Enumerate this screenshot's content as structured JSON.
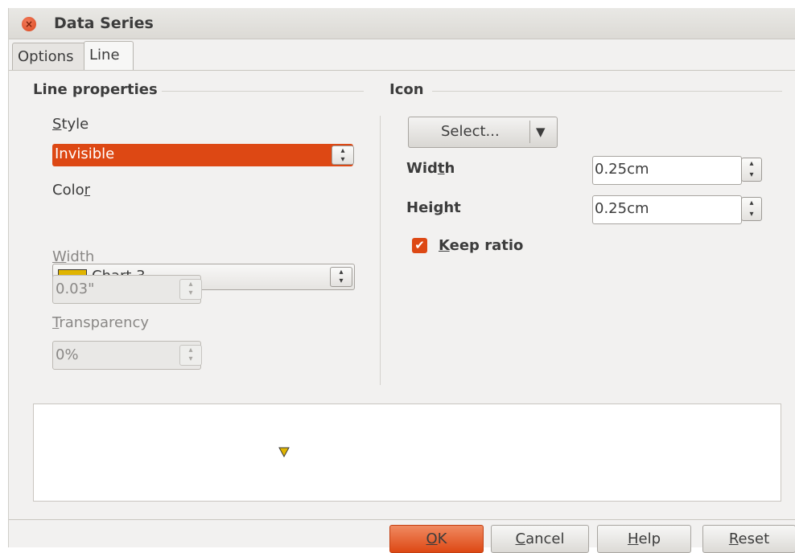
{
  "window": {
    "title": "Data Series"
  },
  "tabs": [
    {
      "label": "Options"
    },
    {
      "label": "Line"
    }
  ],
  "line_properties": {
    "title": "Line properties",
    "style": {
      "label_u": "S",
      "label_rest": "tyle",
      "value": "Invisible"
    },
    "color": {
      "label_pre": "Colo",
      "label_u": "r",
      "value": "Chart 3",
      "swatch": "#e0b400"
    },
    "width": {
      "label_u": "W",
      "label_rest": "idth",
      "value": "0.03\""
    },
    "transparency": {
      "label_u": "T",
      "label_rest": "ransparency",
      "value": "0%"
    }
  },
  "icon": {
    "title": "Icon",
    "select_label": "Select...",
    "width": {
      "label_pre": "Wid",
      "label_u": "t",
      "label_rest": "h",
      "value": "0.25cm"
    },
    "height": {
      "label_pre": "Hei",
      "label_u": "g",
      "label_rest": "ht",
      "value": "0.25cm"
    },
    "keep_ratio": {
      "label_u": "K",
      "label_rest": "eep ratio",
      "checked": true
    }
  },
  "buttons": {
    "ok": {
      "label_u": "O",
      "label_rest": "K"
    },
    "cancel": {
      "label_u": "C",
      "label_rest": "ancel"
    },
    "help": {
      "label_u": "H",
      "label_rest": "elp"
    },
    "reset": {
      "label_u": "R",
      "label_rest": "eset"
    }
  },
  "colors": {
    "accent": "#dd4814",
    "marker": "#e0b400"
  }
}
